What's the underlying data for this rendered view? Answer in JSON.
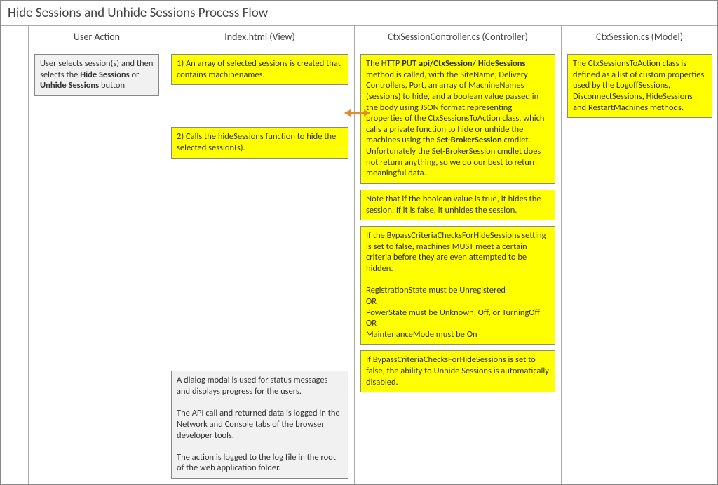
{
  "title": "Hide Sessions and Unhide Sessions Process Flow",
  "columns": {
    "user_action": "User Action",
    "view": "Index.html (View)",
    "controller": "CtxSessionController.cs (Controller)",
    "model": "CtxSession.cs (Model)"
  },
  "user_action": {
    "seg1": "User selects session(s) and then selects the ",
    "bold1": "Hide Sessions",
    "seg2": " or ",
    "bold2": "Unhide Sessions",
    "seg3": " button"
  },
  "view": {
    "step1": "1) An array of selected sessions is created that contains machinenames.",
    "step2": "2) Calls the hideSessions function to hide the selected session(s).",
    "notes": "A dialog modal is used for status messages and displays progress for the users.\n\nThe API call and returned data is logged in the Network and Console tabs of the browser developer tools.\n\nThe action is logged to the log file in the root of the web application folder."
  },
  "controller": {
    "main_seg1": "The HTTP ",
    "main_bold1": "PUT api/CtxSession/ HideSessions",
    "main_seg2": " method is called, with the SiteName, Delivery Controllers, Port, an array of MachineNames (sessions) to hide, and a boolean value passed in the body using JSON format representing properties of the CtxSessionsToAction class, which calls a private function to hide or unhide the machines using the ",
    "main_bold2": "Set-BrokerSession",
    "main_seg3": " cmdlet. Unfortunately the Set-BrokerSession cmdlet does not return anything, so we do our best to return meaningful data.",
    "boolean_note": "Note that if the boolean value is true, it hides the session. If it is false, it unhides the session.",
    "criteria": "If the BypassCriteriaChecksForHideSessions setting is set to false, machines MUST meet a certain criteria before they are even attempted to be hidden.\n\nRegistrationState must be Unregistered\n                                  OR\nPowerState must be Unknown, Off, or TurningOff\n                                  OR\nMaintenanceMode must be On",
    "unhide_note": "If BypassCriteriaChecksForHideSessions is set to false, the ability to Unhide Sessions is automatically disabled."
  },
  "model": {
    "text": "The CtxSessionsToAction class is defined as a list of custom properties used by the LogoffSessions, DisconnectSessions, HideSessions and RestartMachines methods."
  }
}
